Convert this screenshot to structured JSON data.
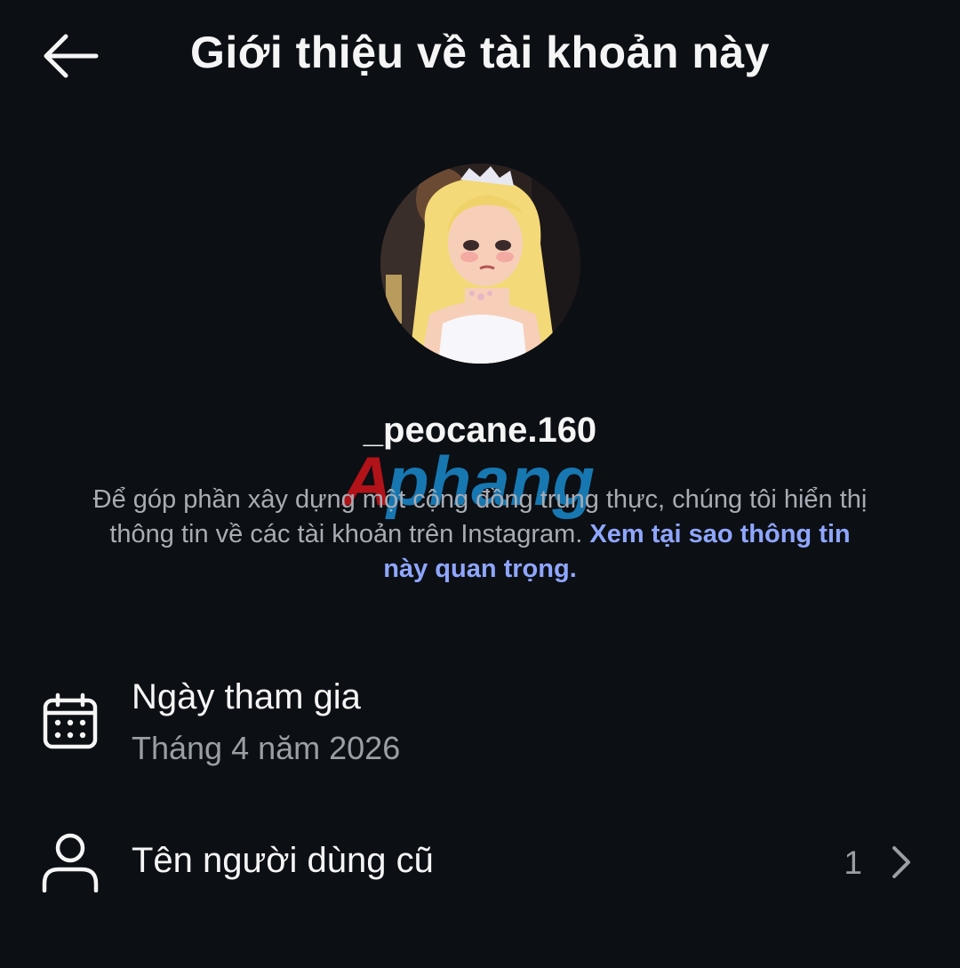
{
  "header": {
    "title": "Giới thiệu về tài khoản này",
    "back_icon": "arrow-left-icon"
  },
  "profile": {
    "username": "_peocane.160",
    "avatar": "avatar-image"
  },
  "watermark": {
    "text": "Aphang"
  },
  "description": {
    "text": "Để góp phần xây dựng một cộng đồng trung thực, chúng tôi hiển thị thông tin về các tài khoản trên Instagram. ",
    "link": "Xem tại sao thông tin này quan trọng."
  },
  "rows": [
    {
      "icon": "calendar-icon",
      "title": "Ngày tham gia",
      "subtitle": "Tháng 4 năm 2026"
    },
    {
      "icon": "person-icon",
      "title": "Tên người dùng cũ",
      "count": "1",
      "trailing_icon": "chevron-right-icon"
    }
  ],
  "colors": {
    "background": "#0c0f14",
    "text": "#f5f5f5",
    "muted": "#a8acb3",
    "link": "#8fa6ff"
  }
}
